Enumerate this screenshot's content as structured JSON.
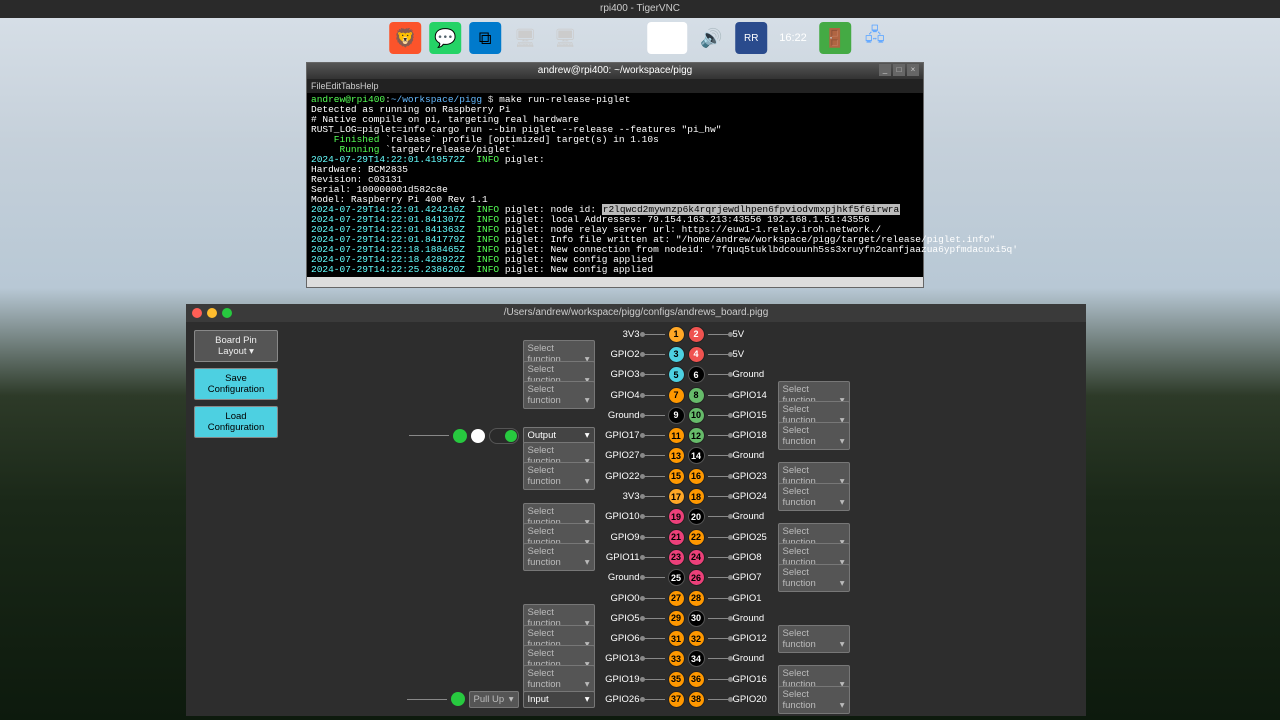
{
  "vnc_title": "rpi400 - TigerVNC",
  "taskbar": {
    "clock": "16:22"
  },
  "terminal": {
    "title": "andrew@rpi400: ~/workspace/pigg",
    "menu": "FileEditTabsHelp",
    "lines": [
      {
        "parts": [
          {
            "t": "andrew@rpi400",
            "c": "c-green"
          },
          {
            "t": ":",
            "c": ""
          },
          {
            "t": "~/workspace/pigg",
            "c": "c-blue"
          },
          {
            "t": " $ ",
            "c": ""
          },
          {
            "t": "make run-release-piglet",
            "c": "c-white"
          }
        ]
      },
      {
        "parts": [
          {
            "t": "Detected as running on Raspberry Pi",
            "c": "c-white"
          }
        ]
      },
      {
        "parts": [
          {
            "t": "# Native compile on pi, targeting real hardware",
            "c": "c-white"
          }
        ]
      },
      {
        "parts": [
          {
            "t": "RUST_LOG=piglet=info cargo run --bin piglet --release --features \"pi_hw\"",
            "c": "c-white"
          }
        ]
      },
      {
        "parts": [
          {
            "t": "    Finished",
            "c": "c-green"
          },
          {
            "t": " `release` profile [optimized] target(s) in 1.10s",
            "c": "c-white"
          }
        ]
      },
      {
        "parts": [
          {
            "t": "     Running",
            "c": "c-green"
          },
          {
            "t": " `target/release/piglet`",
            "c": "c-white"
          }
        ]
      },
      {
        "parts": [
          {
            "t": "2024-07-29T14:22:01.419572Z  ",
            "c": "c-cyan"
          },
          {
            "t": "INFO",
            "c": "c-green"
          },
          {
            "t": " piglet:",
            "c": "c-white"
          }
        ]
      },
      {
        "parts": [
          {
            "t": "Hardware: BCM2835",
            "c": "c-white"
          }
        ]
      },
      {
        "parts": [
          {
            "t": "Revision: c03131",
            "c": "c-white"
          }
        ]
      },
      {
        "parts": [
          {
            "t": "Serial: 100000001d582c8e",
            "c": "c-white"
          }
        ]
      },
      {
        "parts": [
          {
            "t": "Model: Raspberry Pi 400 Rev 1.1",
            "c": "c-white"
          }
        ]
      },
      {
        "parts": [
          {
            "t": "2024-07-29T14:22:01.424216Z  ",
            "c": "c-cyan"
          },
          {
            "t": "INFO",
            "c": "c-green"
          },
          {
            "t": " piglet: node id: ",
            "c": "c-white"
          },
          {
            "t": "r2lqwcd2mywnzp6k4rqrjewdlhpen6fpviodvmxpjhkf5f6irwra",
            "c": "c-hl"
          }
        ]
      },
      {
        "parts": [
          {
            "t": "2024-07-29T14:22:01.841307Z  ",
            "c": "c-cyan"
          },
          {
            "t": "INFO",
            "c": "c-green"
          },
          {
            "t": " piglet: local Addresses: 79.154.163.213:43556 192.168.1.51:43556",
            "c": "c-white"
          }
        ]
      },
      {
        "parts": [
          {
            "t": "2024-07-29T14:22:01.841363Z  ",
            "c": "c-cyan"
          },
          {
            "t": "INFO",
            "c": "c-green"
          },
          {
            "t": " piglet: node relay server url: https://euw1-1.relay.iroh.network./",
            "c": "c-white"
          }
        ]
      },
      {
        "parts": [
          {
            "t": "2024-07-29T14:22:01.841779Z  ",
            "c": "c-cyan"
          },
          {
            "t": "INFO",
            "c": "c-green"
          },
          {
            "t": " piglet: Info file written at: \"/home/andrew/workspace/pigg/target/release/piglet.info\"",
            "c": "c-white"
          }
        ]
      },
      {
        "parts": [
          {
            "t": "2024-07-29T14:22:18.188465Z  ",
            "c": "c-cyan"
          },
          {
            "t": "INFO",
            "c": "c-green"
          },
          {
            "t": " piglet: New connection from nodeid: '7fquq5tuklbdcouunh5ss3xruyfn2canfjaazua6ypfmdacuxi5q'",
            "c": "c-white"
          }
        ]
      },
      {
        "parts": [
          {
            "t": "2024-07-29T14:22:18.428922Z  ",
            "c": "c-cyan"
          },
          {
            "t": "INFO",
            "c": "c-green"
          },
          {
            "t": " piglet: New config applied",
            "c": "c-white"
          }
        ]
      },
      {
        "parts": [
          {
            "t": "2024-07-29T14:22:25.238620Z  ",
            "c": "c-cyan"
          },
          {
            "t": "INFO",
            "c": "c-green"
          },
          {
            "t": " piglet: New config applied",
            "c": "c-white"
          }
        ]
      }
    ]
  },
  "board": {
    "title": "/Users/andrew/workspace/pigg/configs/andrews_board.pigg",
    "layout_btn": "Board Pin Layout",
    "save_btn": "Save Configuration",
    "load_btn": "Load Configuration",
    "sel_label": "Select function",
    "output_label": "Output",
    "input_label": "Input",
    "pullup_label": "Pull Up",
    "pins": [
      {
        "ln": "3V3",
        "lp": 1,
        "lc": "pin-yellow",
        "rp": 2,
        "rc": "pin-red",
        "rn": "5V"
      },
      {
        "ln": "GPIO2",
        "lp": 3,
        "lc": "pin-cyan",
        "rp": 4,
        "rc": "pin-red",
        "rn": "5V",
        "lsel": true
      },
      {
        "ln": "GPIO3",
        "lp": 5,
        "lc": "pin-cyan",
        "rp": 6,
        "rc": "pin-black",
        "rn": "Ground",
        "lsel": true
      },
      {
        "ln": "GPIO4",
        "lp": 7,
        "lc": "pin-orange",
        "rp": 8,
        "rc": "pin-green",
        "rn": "GPIO14",
        "lsel": true,
        "rsel": true
      },
      {
        "ln": "Ground",
        "lp": 9,
        "lc": "pin-black",
        "rp": 10,
        "rc": "pin-green",
        "rn": "GPIO15",
        "rsel": true
      },
      {
        "ln": "GPIO17",
        "lp": 11,
        "lc": "pin-orange",
        "rp": 12,
        "rc": "pin-green",
        "rn": "GPIO18",
        "lctrl": "output",
        "rsel": true
      },
      {
        "ln": "GPIO27",
        "lp": 13,
        "lc": "pin-orange",
        "rp": 14,
        "rc": "pin-black",
        "rn": "Ground",
        "lsel": true
      },
      {
        "ln": "GPIO22",
        "lp": 15,
        "lc": "pin-orange",
        "rp": 16,
        "rc": "pin-orange",
        "rn": "GPIO23",
        "lsel": true,
        "rsel": true
      },
      {
        "ln": "3V3",
        "lp": 17,
        "lc": "pin-yellow",
        "rp": 18,
        "rc": "pin-orange",
        "rn": "GPIO24",
        "rsel": true
      },
      {
        "ln": "GPIO10",
        "lp": 19,
        "lc": "pin-magenta",
        "rp": 20,
        "rc": "pin-black",
        "rn": "Ground",
        "lsel": true
      },
      {
        "ln": "GPIO9",
        "lp": 21,
        "lc": "pin-magenta",
        "rp": 22,
        "rc": "pin-orange",
        "rn": "GPIO25",
        "lsel": true,
        "rsel": true
      },
      {
        "ln": "GPIO11",
        "lp": 23,
        "lc": "pin-magenta",
        "rp": 24,
        "rc": "pin-magenta",
        "rn": "GPIO8",
        "lsel": true,
        "rsel": true
      },
      {
        "ln": "Ground",
        "lp": 25,
        "lc": "pin-black",
        "rp": 26,
        "rc": "pin-magenta",
        "rn": "GPIO7",
        "rsel": true
      },
      {
        "ln": "GPIO0",
        "lp": 27,
        "lc": "pin-orange",
        "rp": 28,
        "rc": "pin-orange",
        "rn": "GPIO1"
      },
      {
        "ln": "GPIO5",
        "lp": 29,
        "lc": "pin-orange",
        "rp": 30,
        "rc": "pin-black",
        "rn": "Ground",
        "lsel": true
      },
      {
        "ln": "GPIO6",
        "lp": 31,
        "lc": "pin-orange",
        "rp": 32,
        "rc": "pin-orange",
        "rn": "GPIO12",
        "lsel": true,
        "rsel": true
      },
      {
        "ln": "GPIO13",
        "lp": 33,
        "lc": "pin-orange",
        "rp": 34,
        "rc": "pin-black",
        "rn": "Ground",
        "lsel": true
      },
      {
        "ln": "GPIO19",
        "lp": 35,
        "lc": "pin-orange",
        "rp": 36,
        "rc": "pin-orange",
        "rn": "GPIO16",
        "lsel": true,
        "rsel": true
      },
      {
        "ln": "GPIO26",
        "lp": 37,
        "lc": "pin-orange",
        "rp": 38,
        "rc": "pin-orange",
        "rn": "GPIO20",
        "lctrl": "input",
        "rsel": true
      }
    ]
  }
}
